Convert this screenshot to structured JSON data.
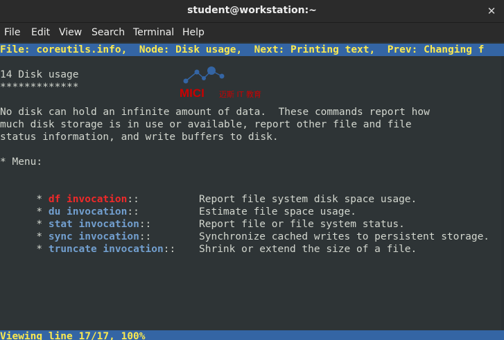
{
  "window": {
    "title": "student@workstation:~"
  },
  "menubar": {
    "items": [
      "File",
      "Edit",
      "View",
      "Search",
      "Terminal",
      "Help"
    ]
  },
  "info": {
    "header_line": "File: coreutils.info,  Node: Disk usage,  Next: Printing text,  Prev: Changing f",
    "heading": "14 Disk usage",
    "underline": "*************",
    "paragraph": [
      "No disk can hold an infinite amount of data.  These commands report how",
      "much disk storage is in use or available, report other file and file",
      "status information, and write buffers to disk."
    ],
    "menu_label": "* Menu:",
    "menu_entries": [
      {
        "name": "df invocation",
        "desc": "Report file system disk space usage.",
        "highlighted": true
      },
      {
        "name": "du invocation",
        "desc": "Estimate file space usage.",
        "highlighted": false
      },
      {
        "name": "stat invocation",
        "desc": "Report file or file system status.",
        "highlighted": false
      },
      {
        "name": "sync invocation",
        "desc": "Synchronize cached writes to persistent storage.",
        "highlighted": false
      },
      {
        "name": "truncate invocation",
        "desc": "Shrink or extend the size of a file.",
        "highlighted": false
      }
    ],
    "bullet": "* ",
    "separator": "::",
    "status_line": "Viewing line 17/17, 100%"
  },
  "watermark": {
    "text_latin": "MICI",
    "text_cn": "迈斯 IT 教育"
  },
  "colors": {
    "terminal_bg": "#2e3436",
    "bar_bg": "#3465a4",
    "bar_fg": "#fce94f",
    "highlight": "#ef2929",
    "link": "#729fcf",
    "text": "#d3d7cf"
  }
}
